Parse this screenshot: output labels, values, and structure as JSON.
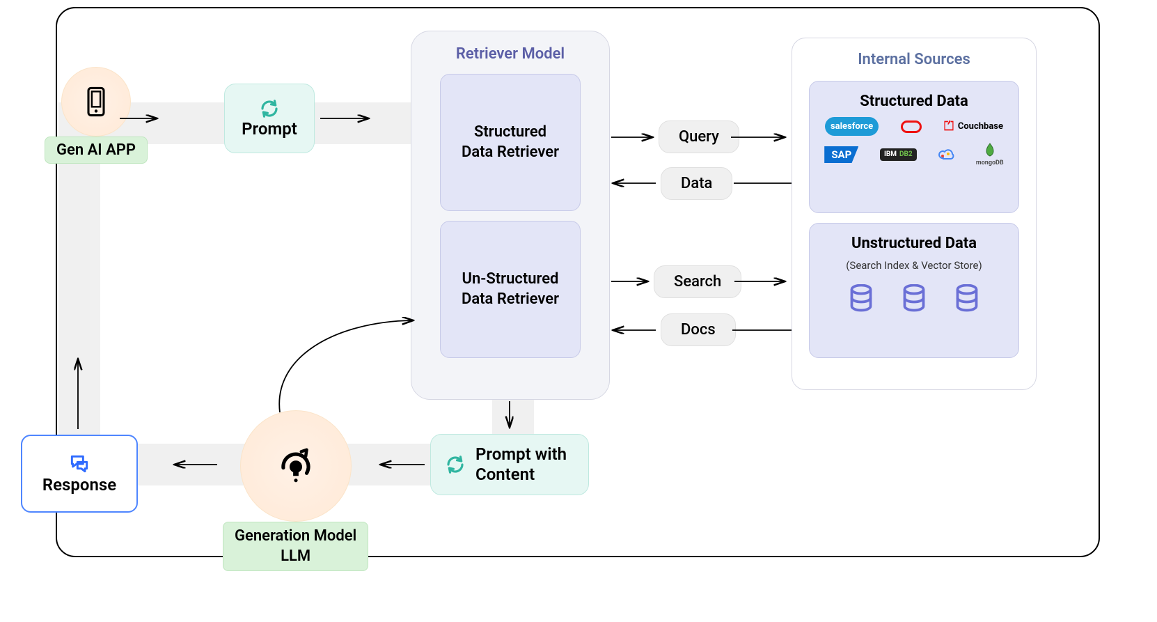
{
  "app": {
    "label": "Gen AI APP"
  },
  "prompt": {
    "label": "Prompt"
  },
  "retriever": {
    "title": "Retriever Model",
    "structured": "Structured\nData Retriever",
    "unstructured": "Un-Structured\nData Retriever"
  },
  "sources": {
    "title": "Internal Sources",
    "structured": {
      "title": "Structured Data",
      "logos": [
        "salesforce",
        "ORACLE",
        "Couchbase",
        "SAP",
        "IBM DB2",
        "GCloud",
        "mongoDB"
      ]
    },
    "unstructured": {
      "title": "Unstructured Data",
      "subtitle": "(Search Index & Vector Store)"
    }
  },
  "pills": {
    "query": "Query",
    "data": "Data",
    "search": "Search",
    "docs": "Docs"
  },
  "promptContent": "Prompt with\nContent",
  "generation": {
    "label": "Generation Model\nLLM"
  },
  "response": {
    "label": "Response"
  }
}
